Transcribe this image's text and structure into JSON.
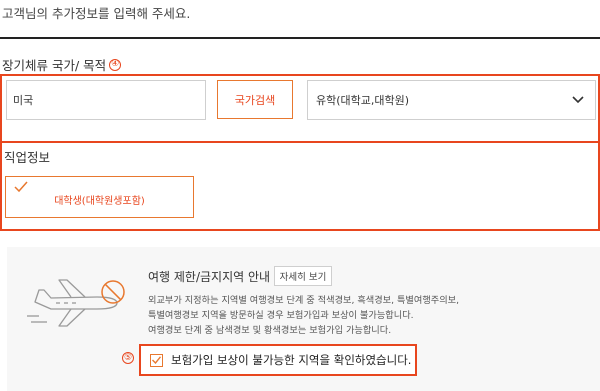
{
  "intro_text": "고객님의 추가정보를 입력해 주세요.",
  "stay_section": {
    "title": "장기체류 국가/ 목적",
    "step_number": "④",
    "country_value": "미국",
    "search_button": "국가검색",
    "purpose_selected": "유학(대학교,대학원)"
  },
  "job_section": {
    "title": "직업정보",
    "selected_job": "대학생(대학원생포함)"
  },
  "travel_notice": {
    "title": "여행 제한/금지지역 안내",
    "detail_button": "자세히 보기",
    "lines": [
      "외교부가 지정하는 지역별 여행경보 단계 중 적색경보, 흑색경보, 특별여행주의보,",
      "특별여행경보 지역을 방문하실 경우 보험가입과 보상이 불가능합니다.",
      "여행경보 단계 중 남색경보 및 황색경보는 보험가입 가능합니다."
    ],
    "step_number": "⑤",
    "confirm_label": "보험가입 보상이 불가능한 지역을 확인하였습니다."
  },
  "colors": {
    "accent": "#e8461e",
    "accent_light": "#e8782f",
    "panel_bg": "#f7f7f7"
  }
}
